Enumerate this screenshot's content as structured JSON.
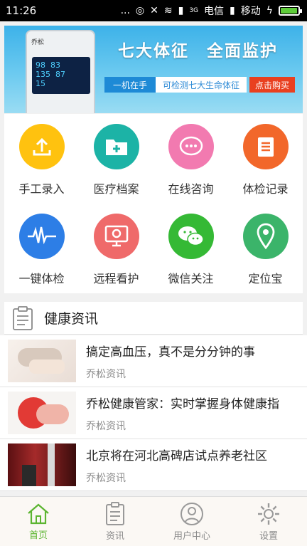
{
  "status_bar": {
    "time": "11:26",
    "dots": "...",
    "network_speed": "3G",
    "carrier1": "电信",
    "carrier2": "移动",
    "battery_level": 0.9,
    "colors": {
      "background": "#000000",
      "battery": "#5ecc3a"
    }
  },
  "banner": {
    "title": "七大体征　全面监护",
    "pill_left": "一机在手",
    "pill_mid": "可检测七大生命体征",
    "pill_button": "点击购买",
    "device_brand": "乔松",
    "device_readings": [
      "98",
      "83",
      "135",
      "87",
      "15"
    ],
    "slides": 2,
    "active_slide": 1
  },
  "grid": {
    "items": [
      {
        "label": "手工录入",
        "icon": "upload-icon",
        "color": "#ffc20f"
      },
      {
        "label": "医疗档案",
        "icon": "folder-icon",
        "color": "#1cb3a6"
      },
      {
        "label": "在线咨询",
        "icon": "chat-icon",
        "color": "#f27ab0"
      },
      {
        "label": "体检记录",
        "icon": "clipboard-icon",
        "color": "#f2672a"
      },
      {
        "label": "一键体检",
        "icon": "heartbeat-icon",
        "color": "#2d7ee6"
      },
      {
        "label": "远程看护",
        "icon": "monitor-icon",
        "color": "#ef6a6a"
      },
      {
        "label": "微信关注",
        "icon": "wechat-icon",
        "color": "#35b935"
      },
      {
        "label": "定位宝",
        "icon": "location-pin-icon",
        "color": "#3bb46a"
      }
    ]
  },
  "news": {
    "header": "健康资讯",
    "items": [
      {
        "headline": "搞定高血压，真不是分分钟的事",
        "source": "乔松资讯"
      },
      {
        "headline": "乔松健康管家：实时掌握身体健康指",
        "source": "乔松资讯"
      },
      {
        "headline": "北京将在河北高碑店试点养老社区",
        "source": "乔松资讯"
      }
    ]
  },
  "tabbar": {
    "items": [
      {
        "label": "首页",
        "icon": "home-icon",
        "active": true
      },
      {
        "label": "资讯",
        "icon": "news-icon",
        "active": false
      },
      {
        "label": "用户中心",
        "icon": "user-icon",
        "active": false
      },
      {
        "label": "设置",
        "icon": "gear-icon",
        "active": false
      }
    ],
    "active_color": "#5cb531"
  }
}
